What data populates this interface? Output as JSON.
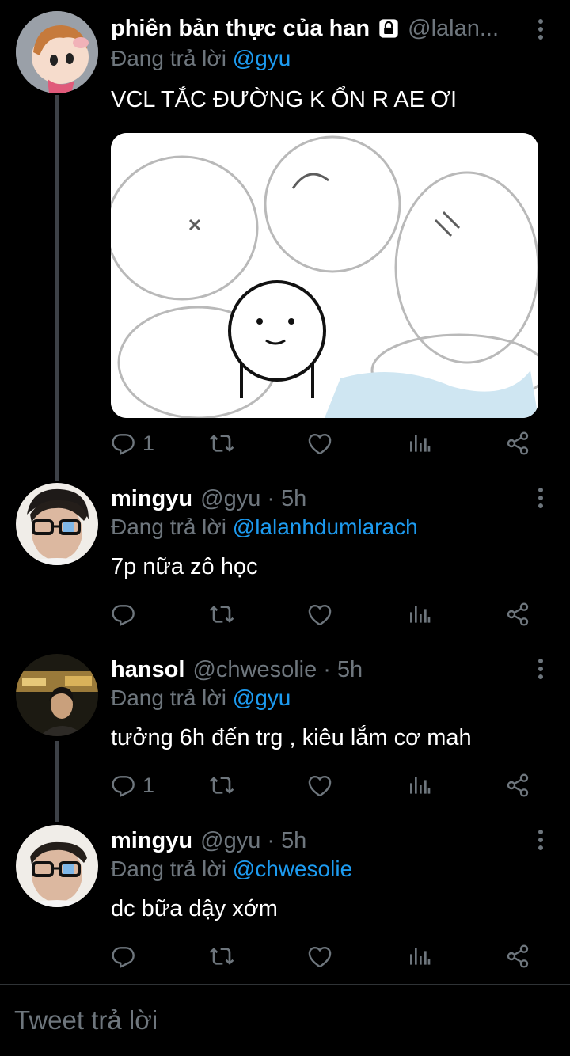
{
  "tweets": [
    {
      "name": "phiên bản thực của han",
      "handle": "@lalan...",
      "time": "",
      "reply_prefix": "Đang trả lời",
      "reply_mention": "@gyu",
      "text": "VCL TẮC ĐƯỜNG K ỔN R AE ƠI",
      "reply_count": "1",
      "has_media": true
    },
    {
      "name": "mingyu",
      "handle": "@gyu",
      "time": "5h",
      "reply_prefix": "Đang trả lời",
      "reply_mention": "@lalanhdumlarach",
      "text": "7p nữa zô học",
      "reply_count": ""
    },
    {
      "name": "hansol",
      "handle": "@chwesolie",
      "time": "5h",
      "reply_prefix": "Đang trả lời",
      "reply_mention": "@gyu",
      "text": "tưởng 6h đến trg , kiêu lắm cơ mah",
      "reply_count": "1"
    },
    {
      "name": "mingyu",
      "handle": "@gyu",
      "time": "5h",
      "reply_prefix": "Đang trả lời",
      "reply_mention": "@chwesolie",
      "text": "dc bữa dậy xớm",
      "reply_count": ""
    }
  ],
  "composer": {
    "placeholder": "Tweet trả lời"
  },
  "colors": {
    "background": "#000000",
    "secondary_text": "#6e767d",
    "accent": "#1d9bf0"
  },
  "icons": [
    "lock-icon",
    "more-icon",
    "reply-icon",
    "retweet-icon",
    "like-icon",
    "analytics-icon",
    "share-icon"
  ]
}
